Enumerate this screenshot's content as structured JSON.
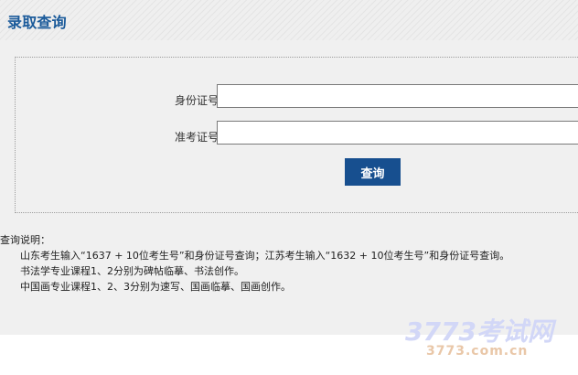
{
  "header": {
    "title": "录取查询"
  },
  "form": {
    "id_label": "身份证号：",
    "id_value": "",
    "exam_label": "准考证号：",
    "exam_value": "",
    "submit_label": "查询"
  },
  "notes": {
    "title": "查询说明：",
    "lines": [
      "山东考生输入“1637 + 10位考生号”和身份证号查询；江苏考生输入“1632 + 10位考生号”和身份证号查询。",
      "书法学专业课程1、2分别为碑帖临摹、书法创作。",
      "中国画专业课程1、2、3分别为速写、国画临摹、国画创作。"
    ]
  },
  "watermark": {
    "main": "3773考试网",
    "sub": "3773.com.cn"
  },
  "colors": {
    "header_title": "#1a5a9a",
    "button_bg": "#174f8f",
    "page_bg": "#f0f0f0"
  }
}
